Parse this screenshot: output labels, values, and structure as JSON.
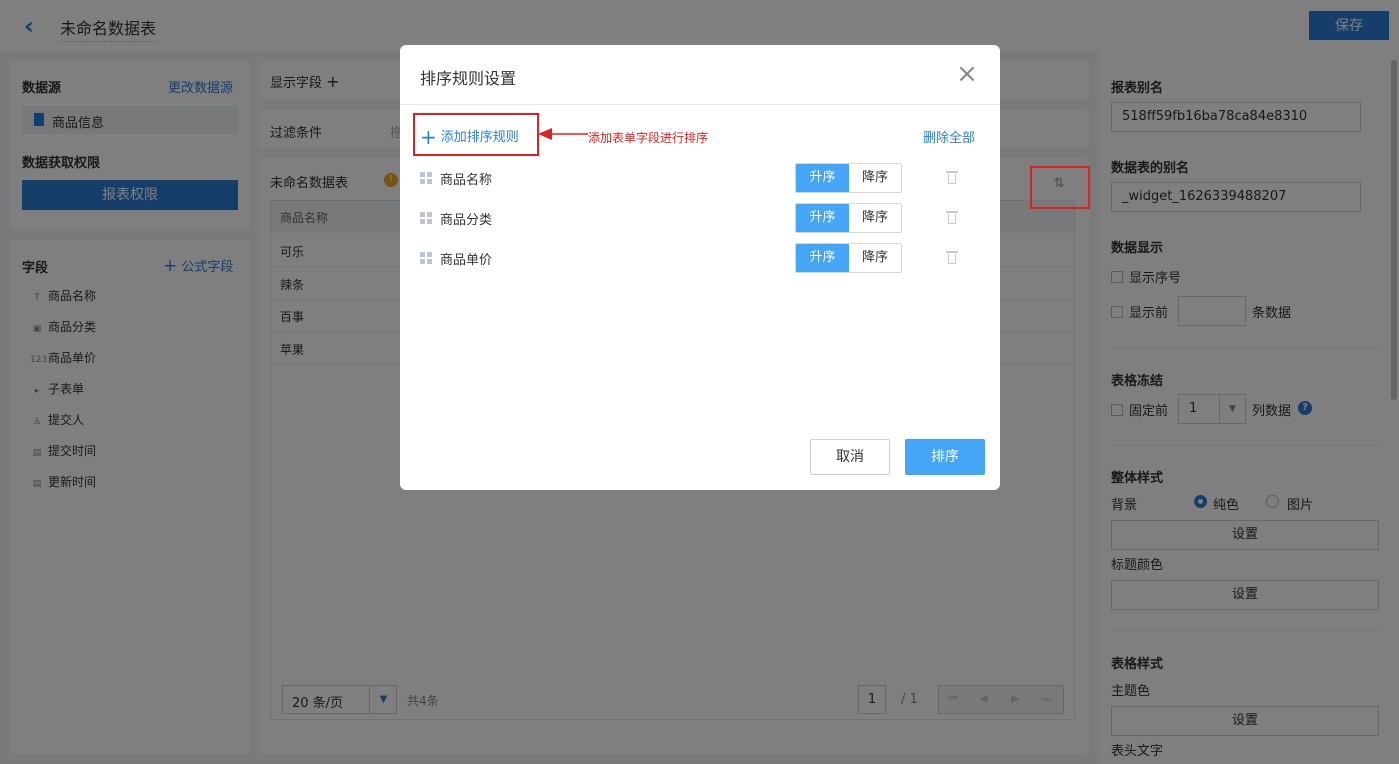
{
  "header": {
    "title": "未命名数据表",
    "save_label": "保存"
  },
  "left": {
    "datasource_label": "数据源",
    "change_datasource": "更改数据源",
    "datasource_value": "商品信息",
    "permission_label": "数据获取权限",
    "permission_button": "报表权限",
    "fields_label": "字段",
    "formula_field": "公式字段",
    "fields": [
      {
        "icon": "T",
        "label": "商品名称"
      },
      {
        "icon": "▣",
        "label": "商品分类"
      },
      {
        "icon": "123",
        "label": "商品单价"
      },
      {
        "icon": "▸",
        "label": "子表单"
      },
      {
        "icon": "♙",
        "label": "提交人"
      },
      {
        "icon": "▤",
        "label": "提交时间"
      },
      {
        "icon": "▤",
        "label": "更新时间"
      }
    ]
  },
  "center": {
    "display_fields_label": "显示字段",
    "filter_label": "过滤条件",
    "filter_hint": "拖",
    "table_title": "未命名数据表",
    "column_header": "商品名称",
    "rows": [
      "可乐",
      "辣条",
      "百事",
      "苹果"
    ],
    "page_size": "20 条/页",
    "total": "共4条",
    "page_current": "1",
    "page_total": "/ 1"
  },
  "right": {
    "report_alias_label": "报表别名",
    "report_alias_value": "518ff59fb16ba78ca84e8310",
    "table_alias_label": "数据表的别名",
    "table_alias_value": "_widget_1626339488207",
    "data_display_label": "数据显示",
    "show_index": "显示序号",
    "show_first": "显示前",
    "rows_suffix": "条数据",
    "freeze_label": "表格冻结",
    "fix_first": "固定前",
    "freeze_value": "1",
    "freeze_suffix": "列数据",
    "overall_style_label": "整体样式",
    "background_label": "背景",
    "solid_color": "纯色",
    "image": "图片",
    "set_button": "设置",
    "title_color_label": "标题颜色",
    "table_style_label": "表格样式",
    "theme_color_label": "主题色",
    "header_text_label": "表头文字"
  },
  "modal": {
    "title": "排序规则设置",
    "add_rule": "添加排序规则",
    "delete_all": "删除全部",
    "rules": [
      {
        "name": "商品名称",
        "asc": "升序",
        "desc": "降序"
      },
      {
        "name": "商品分类",
        "asc": "升序",
        "desc": "降序"
      },
      {
        "name": "商品单价",
        "asc": "升序",
        "desc": "降序"
      }
    ],
    "cancel": "取消",
    "confirm": "排序"
  },
  "annotation": {
    "text": "添加表单字段进行排序"
  }
}
